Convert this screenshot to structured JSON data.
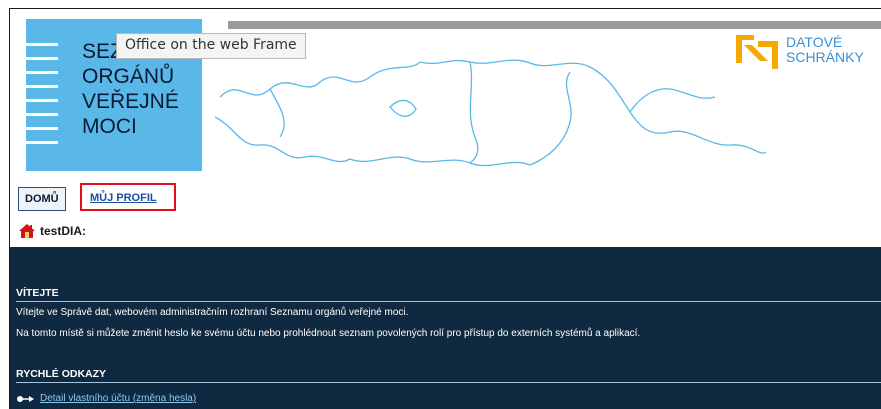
{
  "header": {
    "logo_lines": [
      "SEZN",
      "ORGÁNŮ",
      "VEŘEJNÉ",
      "MOCI"
    ],
    "tooltip": "Office on the web Frame",
    "brand": [
      "DATOVÉ",
      "SCHRÁNKY"
    ],
    "brand_colors": {
      "mark": "#f6a800",
      "text": "#3a8fd4"
    }
  },
  "nav": {
    "home": "DOMŮ",
    "profile": "MŮJ PROFIL"
  },
  "user": {
    "name": "testDIA:"
  },
  "welcome": {
    "title": "VÍTEJTE",
    "line1": "Vítejte ve Správě dat, webovém administračním rozhraní Seznamu orgánů veřejné moci.",
    "line2": "Na tomto místě si můžete změnit heslo ke svému účtu nebo prohlédnout seznam povolených rolí pro přístup do externích systémů a aplikací."
  },
  "quick": {
    "title": "RYCHLÉ ODKAZY",
    "link": "Detail vlastního účtu (změna hesla)"
  },
  "colors": {
    "logo_bg": "#5ab8e8",
    "dark_bg": "#0f2a40",
    "highlight": "#e2101c"
  }
}
